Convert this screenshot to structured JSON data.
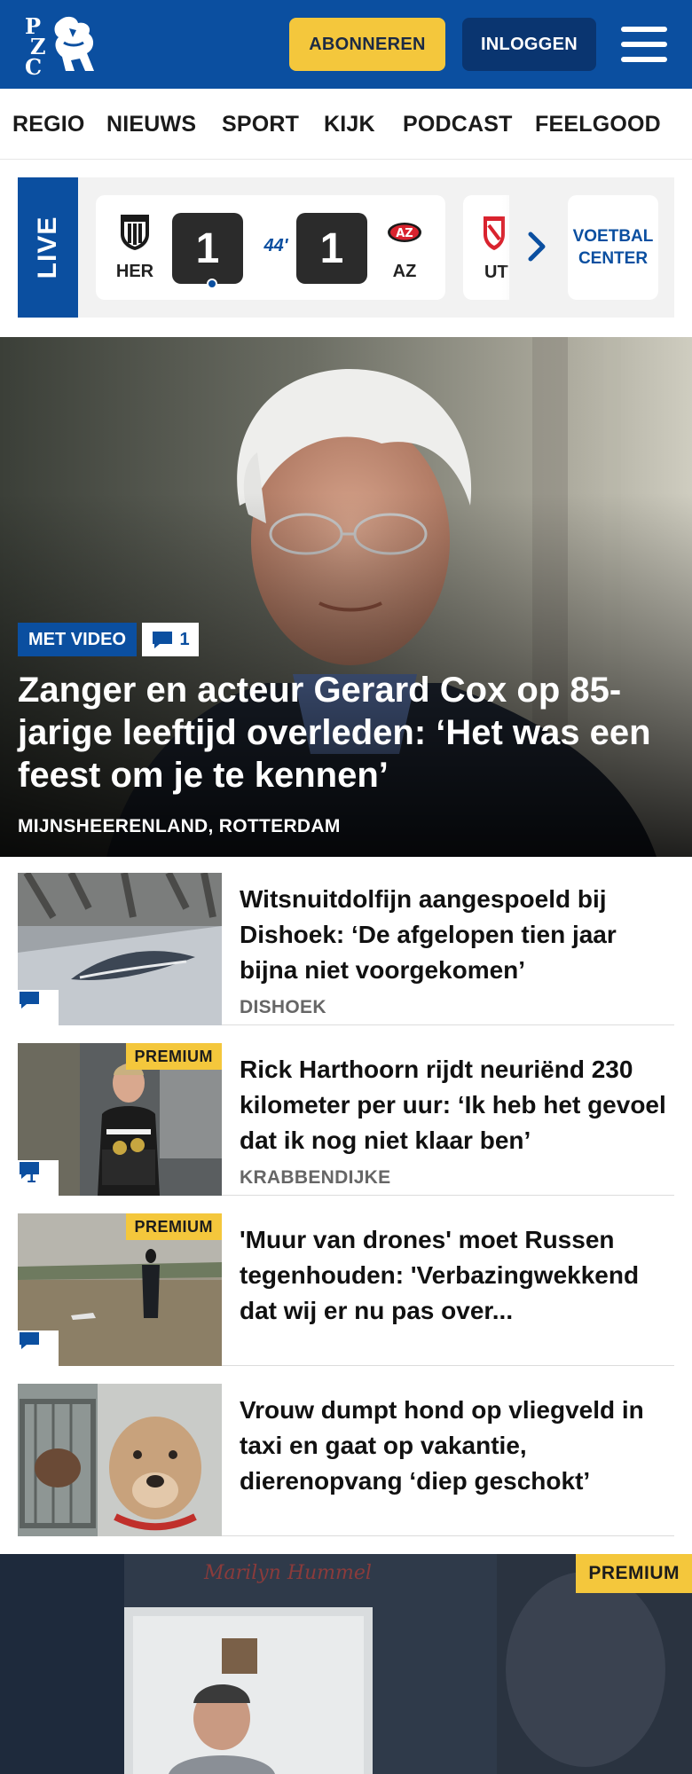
{
  "header": {
    "logo_text": "PZC",
    "subscribe_label": "ABONNEREN",
    "login_label": "INLOGGEN",
    "menu_icon": "hamburger-menu-icon",
    "brand_color": "#0b4fa0",
    "accent_color": "#f4c73c"
  },
  "nav": {
    "items": [
      "REGIO",
      "NIEUWS",
      "SPORT",
      "KIJK",
      "PODCAST",
      "FEELGOOD"
    ]
  },
  "live": {
    "label": "LIVE",
    "match": {
      "home_team": "HER",
      "home_score": "1",
      "minute": "44'",
      "away_score": "1",
      "away_team": "AZ"
    },
    "next_match": {
      "home_team": "UT"
    },
    "voetbal_center_line1": "VOETBAL",
    "voetbal_center_line2": "CENTER"
  },
  "hero": {
    "badge": "MET VIDEO",
    "comments": "1",
    "title": "Zanger en acteur Gerard Cox op 85-jarige leeftijd overleden: ‘Het was een feest om je te kennen’",
    "location": "MIJNSHEERENLAND, ROTTERDAM"
  },
  "articles": [
    {
      "title": "Witsnuitdolfijn aangespoeld bij Dishoek: ‘De afgelopen tien jaar bijna niet voorgekomen’",
      "location": "DISHOEK",
      "premium": "",
      "comments": ""
    },
    {
      "title": "Rick Harthoorn rijdt neuriënd 230 kilometer per uur: ‘Ik heb het gevoel dat ik nog niet klaar ben’",
      "location": "KRABBENDIJKE",
      "premium": "PREMIUM",
      "comments": "1"
    },
    {
      "title": "'Muur van drones' moet Russen tegenhouden: 'Verbazingwekkend dat wij er nu pas over...",
      "location": "",
      "premium": "PREMIUM",
      "comments": ""
    },
    {
      "title": "Vrouw dumpt hond op vliegveld in taxi en gaat op vakantie, dierenopvang ‘diep geschokt’",
      "location": "",
      "premium": "",
      "comments": ""
    }
  ],
  "feature": {
    "premium": "PREMIUM"
  }
}
